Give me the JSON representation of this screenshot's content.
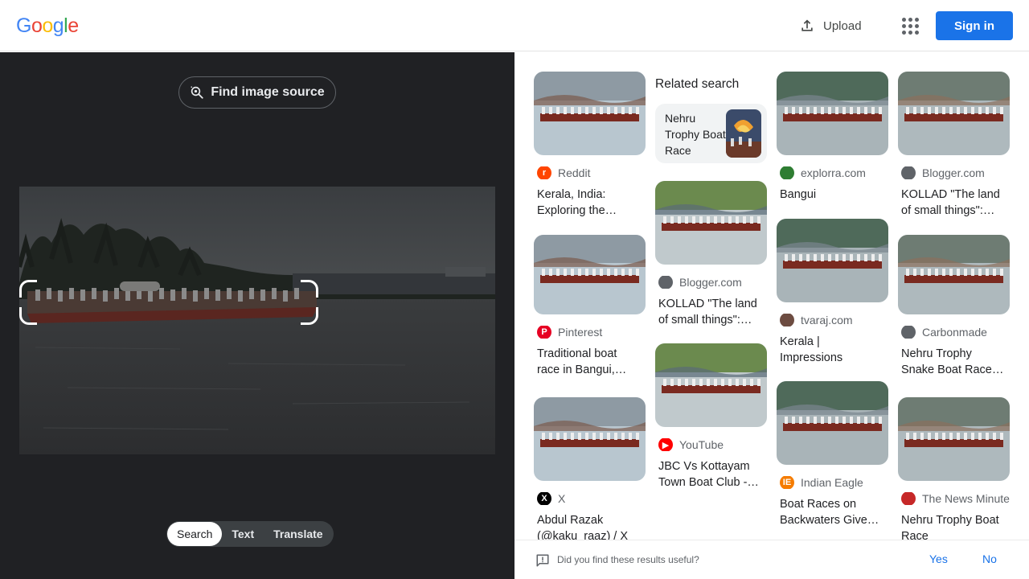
{
  "header": {
    "logo_letters": [
      {
        "ch": "G",
        "color": "#4285f4"
      },
      {
        "ch": "o",
        "color": "#ea4335"
      },
      {
        "ch": "o",
        "color": "#fbbc05"
      },
      {
        "ch": "g",
        "color": "#4285f4"
      },
      {
        "ch": "l",
        "color": "#34a853"
      },
      {
        "ch": "e",
        "color": "#ea4335"
      }
    ],
    "upload_label": "Upload",
    "apps_icon": "apps-grid-icon",
    "signin_label": "Sign in"
  },
  "left": {
    "find_source_label": "Find image source",
    "mode_tabs": [
      {
        "label": "Search",
        "active": true
      },
      {
        "label": "Text",
        "active": false
      },
      {
        "label": "Translate",
        "active": false
      }
    ]
  },
  "results": {
    "related_heading": "Related search",
    "related_item": "Nehru Trophy Boat Race",
    "columns": [
      [
        {
          "source": "Reddit",
          "icon_color": "#ff4500",
          "icon_char": "r",
          "title": "Kerala, India: Exploring the Traditions"
        },
        {
          "source": "Pinterest",
          "icon_color": "#e60023",
          "icon_char": "P",
          "title": "Traditional boat race in Bangui, Kerala"
        },
        {
          "source": "X",
          "icon_color": "#000000",
          "icon_char": "X",
          "title": "Abdul Razak (@kaku_raaz) / X"
        }
      ],
      [
        {
          "source": "Blogger.com",
          "icon_color": "#5f6368",
          "icon_char": "",
          "title": "KOLLAD \"The land of small things\": Boat"
        },
        {
          "source": "YouTube",
          "icon_color": "#ff0000",
          "icon_char": "▶",
          "title": "JBC Vs Kottayam Town Boat Club - Race"
        }
      ],
      [
        {
          "source": "explorra.com",
          "icon_color": "#2e7d32",
          "icon_char": "",
          "title": "Bangui"
        },
        {
          "source": "tvaraj.com",
          "icon_color": "#6d4c41",
          "icon_char": "",
          "title": "Kerala | Impressions"
        },
        {
          "source": "Indian Eagle",
          "icon_color": "#f57c00",
          "icon_char": "IE",
          "title": "Boat Races on Backwaters Give Kerala"
        }
      ],
      [
        {
          "source": "Blogger.com",
          "icon_color": "#5f6368",
          "icon_char": "",
          "title": "KOLLAD \"The land of small things\": Boat"
        },
        {
          "source": "Carbonmade",
          "icon_color": "#5f6368",
          "icon_char": "",
          "title": "Nehru Trophy Snake Boat Race Kerala"
        },
        {
          "source": "The News Minute",
          "icon_color": "#c62828",
          "icon_char": "",
          "title": "Nehru Trophy Boat Race"
        }
      ]
    ]
  },
  "footer": {
    "question": "Did you find these results useful?",
    "yes_label": "Yes",
    "no_label": "No"
  }
}
